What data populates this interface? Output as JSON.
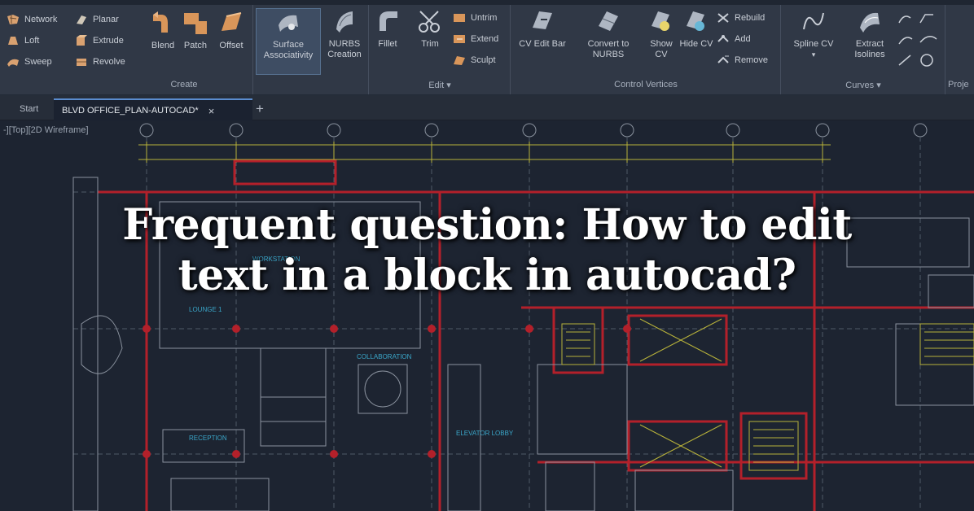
{
  "ribbon": {
    "panels": {
      "create": {
        "label": "Create",
        "small": [
          "Network",
          "Loft",
          "Sweep",
          "Planar",
          "Extrude",
          "Revolve"
        ],
        "big": [
          "Blend",
          "Patch",
          "Offset",
          "Surface Associativity",
          "NURBS Creation"
        ]
      },
      "edit": {
        "label": "Edit",
        "big": [
          "Fillet",
          "Trim"
        ],
        "small": [
          "Untrim",
          "Extend",
          "Sculpt"
        ]
      },
      "control_vertices": {
        "label": "Control Vertices",
        "big": [
          "CV Edit Bar",
          "Convert to NURBS",
          "Show CV",
          "Hide CV"
        ],
        "small": [
          "Rebuild",
          "Add",
          "Remove"
        ]
      },
      "curves": {
        "label": "Curves",
        "big": [
          "Spline CV",
          "Extract Isolines"
        ]
      },
      "project": {
        "label": "Proje"
      }
    }
  },
  "tabs": {
    "start": "Start",
    "document": "BLVD OFFICE_PLAN-AUTOCAD*",
    "close_glyph": "×",
    "add_glyph": "+"
  },
  "viewport": {
    "label": "-][Top][2D Wireframe]"
  },
  "headline": {
    "line1": "Frequent question: How to edit",
    "line2": "text in a block in autocad?"
  },
  "plan_labels": {
    "lounge": "LOUNGE 1",
    "collaboration": "COLLABORATION",
    "reception": "RECEPTION",
    "elevator_lobby": "ELEVATOR LOBBY",
    "workstation": "WORKSTATION"
  },
  "colors": {
    "ribbon_bg": "#303846",
    "drawing_bg": "#1d2431",
    "accent_orange": "#d9965a",
    "line_yellow": "#b8b23a",
    "line_red": "#b3202a",
    "line_gray": "#8a929e",
    "text_cyan": "#3aa6c9"
  }
}
